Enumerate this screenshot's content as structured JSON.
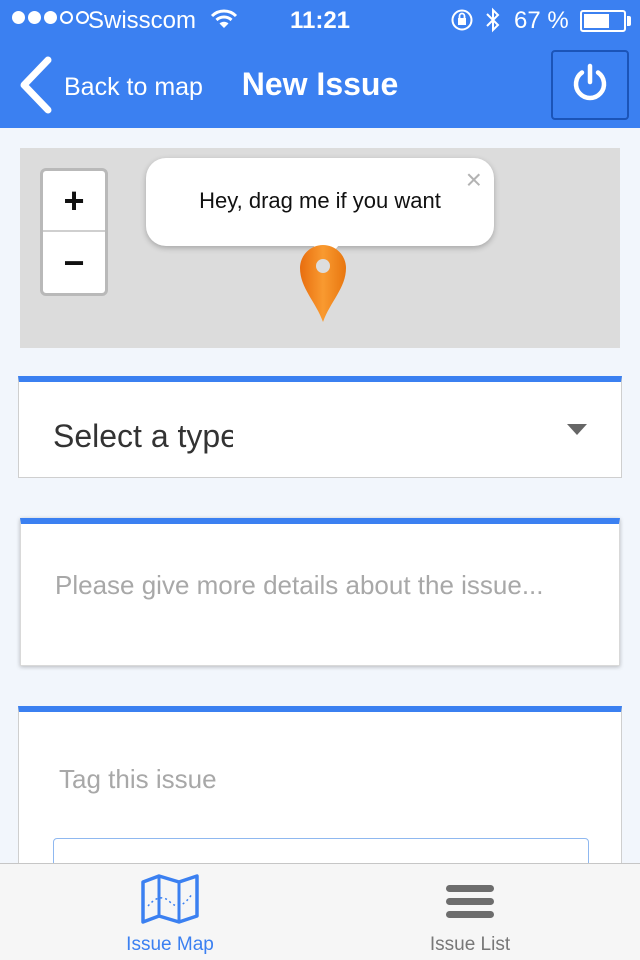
{
  "status_bar": {
    "carrier": "Swisscom",
    "time": "11:21",
    "battery_percent": "67 %",
    "battery_level": 0.67,
    "signal_strength": 3
  },
  "nav": {
    "back_label": "Back to map",
    "title": "New Issue",
    "power_icon": "power-icon"
  },
  "map": {
    "zoom_in": "+",
    "zoom_out": "−",
    "popup_text": "Hey, drag me if you want",
    "popup_close": "×",
    "marker_color": "#f7861d"
  },
  "form": {
    "type_select_value": "Select a type",
    "details_placeholder": "Please give more details about the issue...",
    "tags_label": "Tag this issue",
    "tags_input_value": ""
  },
  "tabbar": {
    "tabs": [
      {
        "label": "Issue Map",
        "icon": "map-icon",
        "active": true
      },
      {
        "label": "Issue List",
        "icon": "list-icon",
        "active": false
      }
    ]
  },
  "colors": {
    "accent": "#3b80f1",
    "marker": "#f7861d"
  }
}
